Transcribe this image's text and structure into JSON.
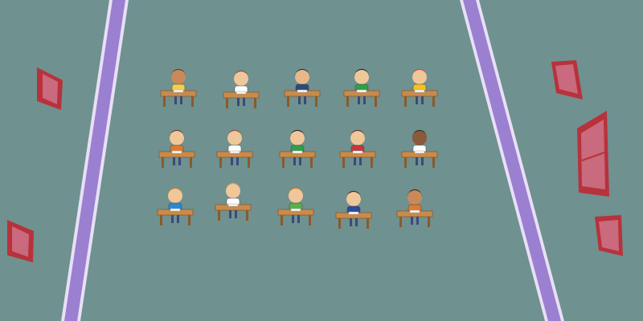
{
  "scene": {
    "background_color": "#6f9190",
    "wall_line_color": "#9b7fd0",
    "wall_line_edge_color": "#e8e0f6",
    "frame_color": "#b8323b",
    "frame_inner_color": "#c96a7e",
    "desk_color": "#c98b4b",
    "desk_leg_color": "#8a5a2b"
  },
  "classroom": {
    "rows": 3,
    "columns": 5,
    "students": [
      {
        "id": "r1c1",
        "shirt": "#f2d14a",
        "hair": "#5a3b1e",
        "skin": "#c98a5a"
      },
      {
        "id": "r1c2",
        "shirt": "#ffffff",
        "hair": "#8a4a1e",
        "skin": "#f0c79a"
      },
      {
        "id": "r1c3",
        "shirt": "#2b4a7a",
        "hair": "#2b2b2b",
        "skin": "#e8b88a"
      },
      {
        "id": "r1c4",
        "shirt": "#2fa04a",
        "hair": "#1e1e1e",
        "skin": "#f0c79a"
      },
      {
        "id": "r1c5",
        "shirt": "#f2c21e",
        "hair": "#e03a3a",
        "skin": "#f0c79a"
      },
      {
        "id": "r2c1",
        "shirt": "#e07a2a",
        "hair": "#6b3b1e",
        "skin": "#f0c79a"
      },
      {
        "id": "r2c2",
        "shirt": "#ffffff",
        "hair": "#a04040",
        "skin": "#f0c79a"
      },
      {
        "id": "r2c3",
        "shirt": "#2fa04a",
        "hair": "#1e1e1e",
        "skin": "#f0c79a"
      },
      {
        "id": "r2c4",
        "shirt": "#c03a3a",
        "hair": "#5a2b1e",
        "skin": "#f0c79a"
      },
      {
        "id": "r2c5",
        "shirt": "#ffffff",
        "hair": "#3b2010",
        "skin": "#8a5a3a"
      },
      {
        "id": "r3c1",
        "shirt": "#2a8ad0",
        "hair": "#c07a3a",
        "skin": "#f0c79a"
      },
      {
        "id": "r3c2",
        "shirt": "#ffffff",
        "hair": "#e0a030",
        "skin": "#f0c79a"
      },
      {
        "id": "r3c3",
        "shirt": "#5ab04a",
        "hair": "#e07a2a",
        "skin": "#f0c79a"
      },
      {
        "id": "r3c4",
        "shirt": "#2b4a9a",
        "hair": "#3b2010",
        "skin": "#f0c79a"
      },
      {
        "id": "r3c5",
        "shirt": "#e07a2a",
        "hair": "#3b2010",
        "skin": "#c98a5a"
      }
    ]
  }
}
